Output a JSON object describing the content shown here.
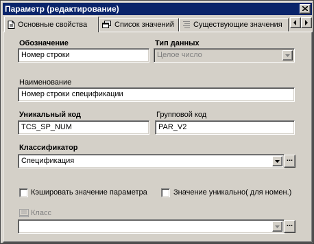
{
  "window": {
    "title": "Параметр (редактирование)"
  },
  "tabs": [
    {
      "label": "Основные свойства",
      "icon": "document-icon",
      "active": true
    },
    {
      "label": "Список значений",
      "icon": "window-list-icon",
      "active": false
    },
    {
      "label": "Существующие значения",
      "icon": "grayed-list-icon",
      "active": false
    }
  ],
  "form": {
    "designation": {
      "label": "Обозначение",
      "value": "Номер строки"
    },
    "data_type": {
      "label": "Тип данных",
      "value": "Целое число"
    },
    "name": {
      "label": "Наименование",
      "value": "Номер строки спецификации"
    },
    "unique_code": {
      "label": "Уникальный код",
      "value": "TCS_SP_NUM"
    },
    "group_code": {
      "label": "Групповой код",
      "value": "PAR_V2"
    },
    "classifier": {
      "label": "Классификатор",
      "value": "Спецификация"
    },
    "cache_checkbox": {
      "label": "Кэшировать значение параметра",
      "checked": false
    },
    "unique_checkbox": {
      "label": "Значение уникально( для номен.)",
      "checked": false
    },
    "class": {
      "label": "Класс",
      "value": ""
    },
    "ellipsis": "..."
  }
}
